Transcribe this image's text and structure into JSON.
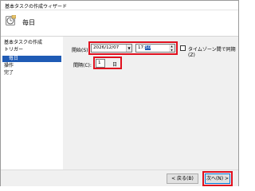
{
  "window": {
    "title": "基本タスクの作成ウィザード"
  },
  "header": {
    "title": "毎日",
    "icon": "task-wizard-icon"
  },
  "steps": [
    {
      "label": "基本タスクの作成"
    },
    {
      "label": "トリガー"
    },
    {
      "label": "毎日"
    },
    {
      "label": "操作"
    },
    {
      "label": "完了"
    }
  ],
  "start": {
    "label": "開始(S):",
    "date": "2026/12/07",
    "time": "17:50",
    "time_selected": "50",
    "timezone_sync_label": "タイムゾーン間で同期(Z)",
    "timezone_sync_checked": false
  },
  "interval": {
    "label": "間隔(C):",
    "value": "1",
    "unit": "日"
  },
  "footer": {
    "back_label": "< 戻る(B)",
    "next_label": "次へ(N) >"
  },
  "colors": {
    "highlight": "#1f5bb5",
    "annotation_red": "#e0101e"
  }
}
